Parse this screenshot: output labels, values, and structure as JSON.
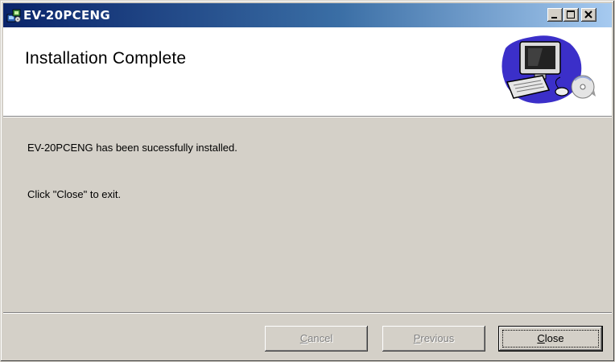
{
  "window": {
    "title": "EV-20PCENG",
    "controls": [
      "minimize-icon",
      "maximize-icon",
      "close-icon"
    ]
  },
  "header": {
    "title": "Installation Complete",
    "image": "computer-setup-icon"
  },
  "body": {
    "message": "EV-20PCENG has been sucessfully installed.",
    "instruction": "Click \"Close\" to exit."
  },
  "buttons": {
    "cancel": {
      "accel": "C",
      "rest": "ancel",
      "enabled": false
    },
    "previous": {
      "accel": "P",
      "rest": "revious",
      "enabled": false
    },
    "close": {
      "accel": "C",
      "rest": "lose",
      "enabled": true
    }
  },
  "colors": {
    "titlebar_start": "#0a246a",
    "titlebar_end": "#a6caf0",
    "dialog_bg": "#d4d0c8",
    "header_bg": "#ffffff"
  }
}
